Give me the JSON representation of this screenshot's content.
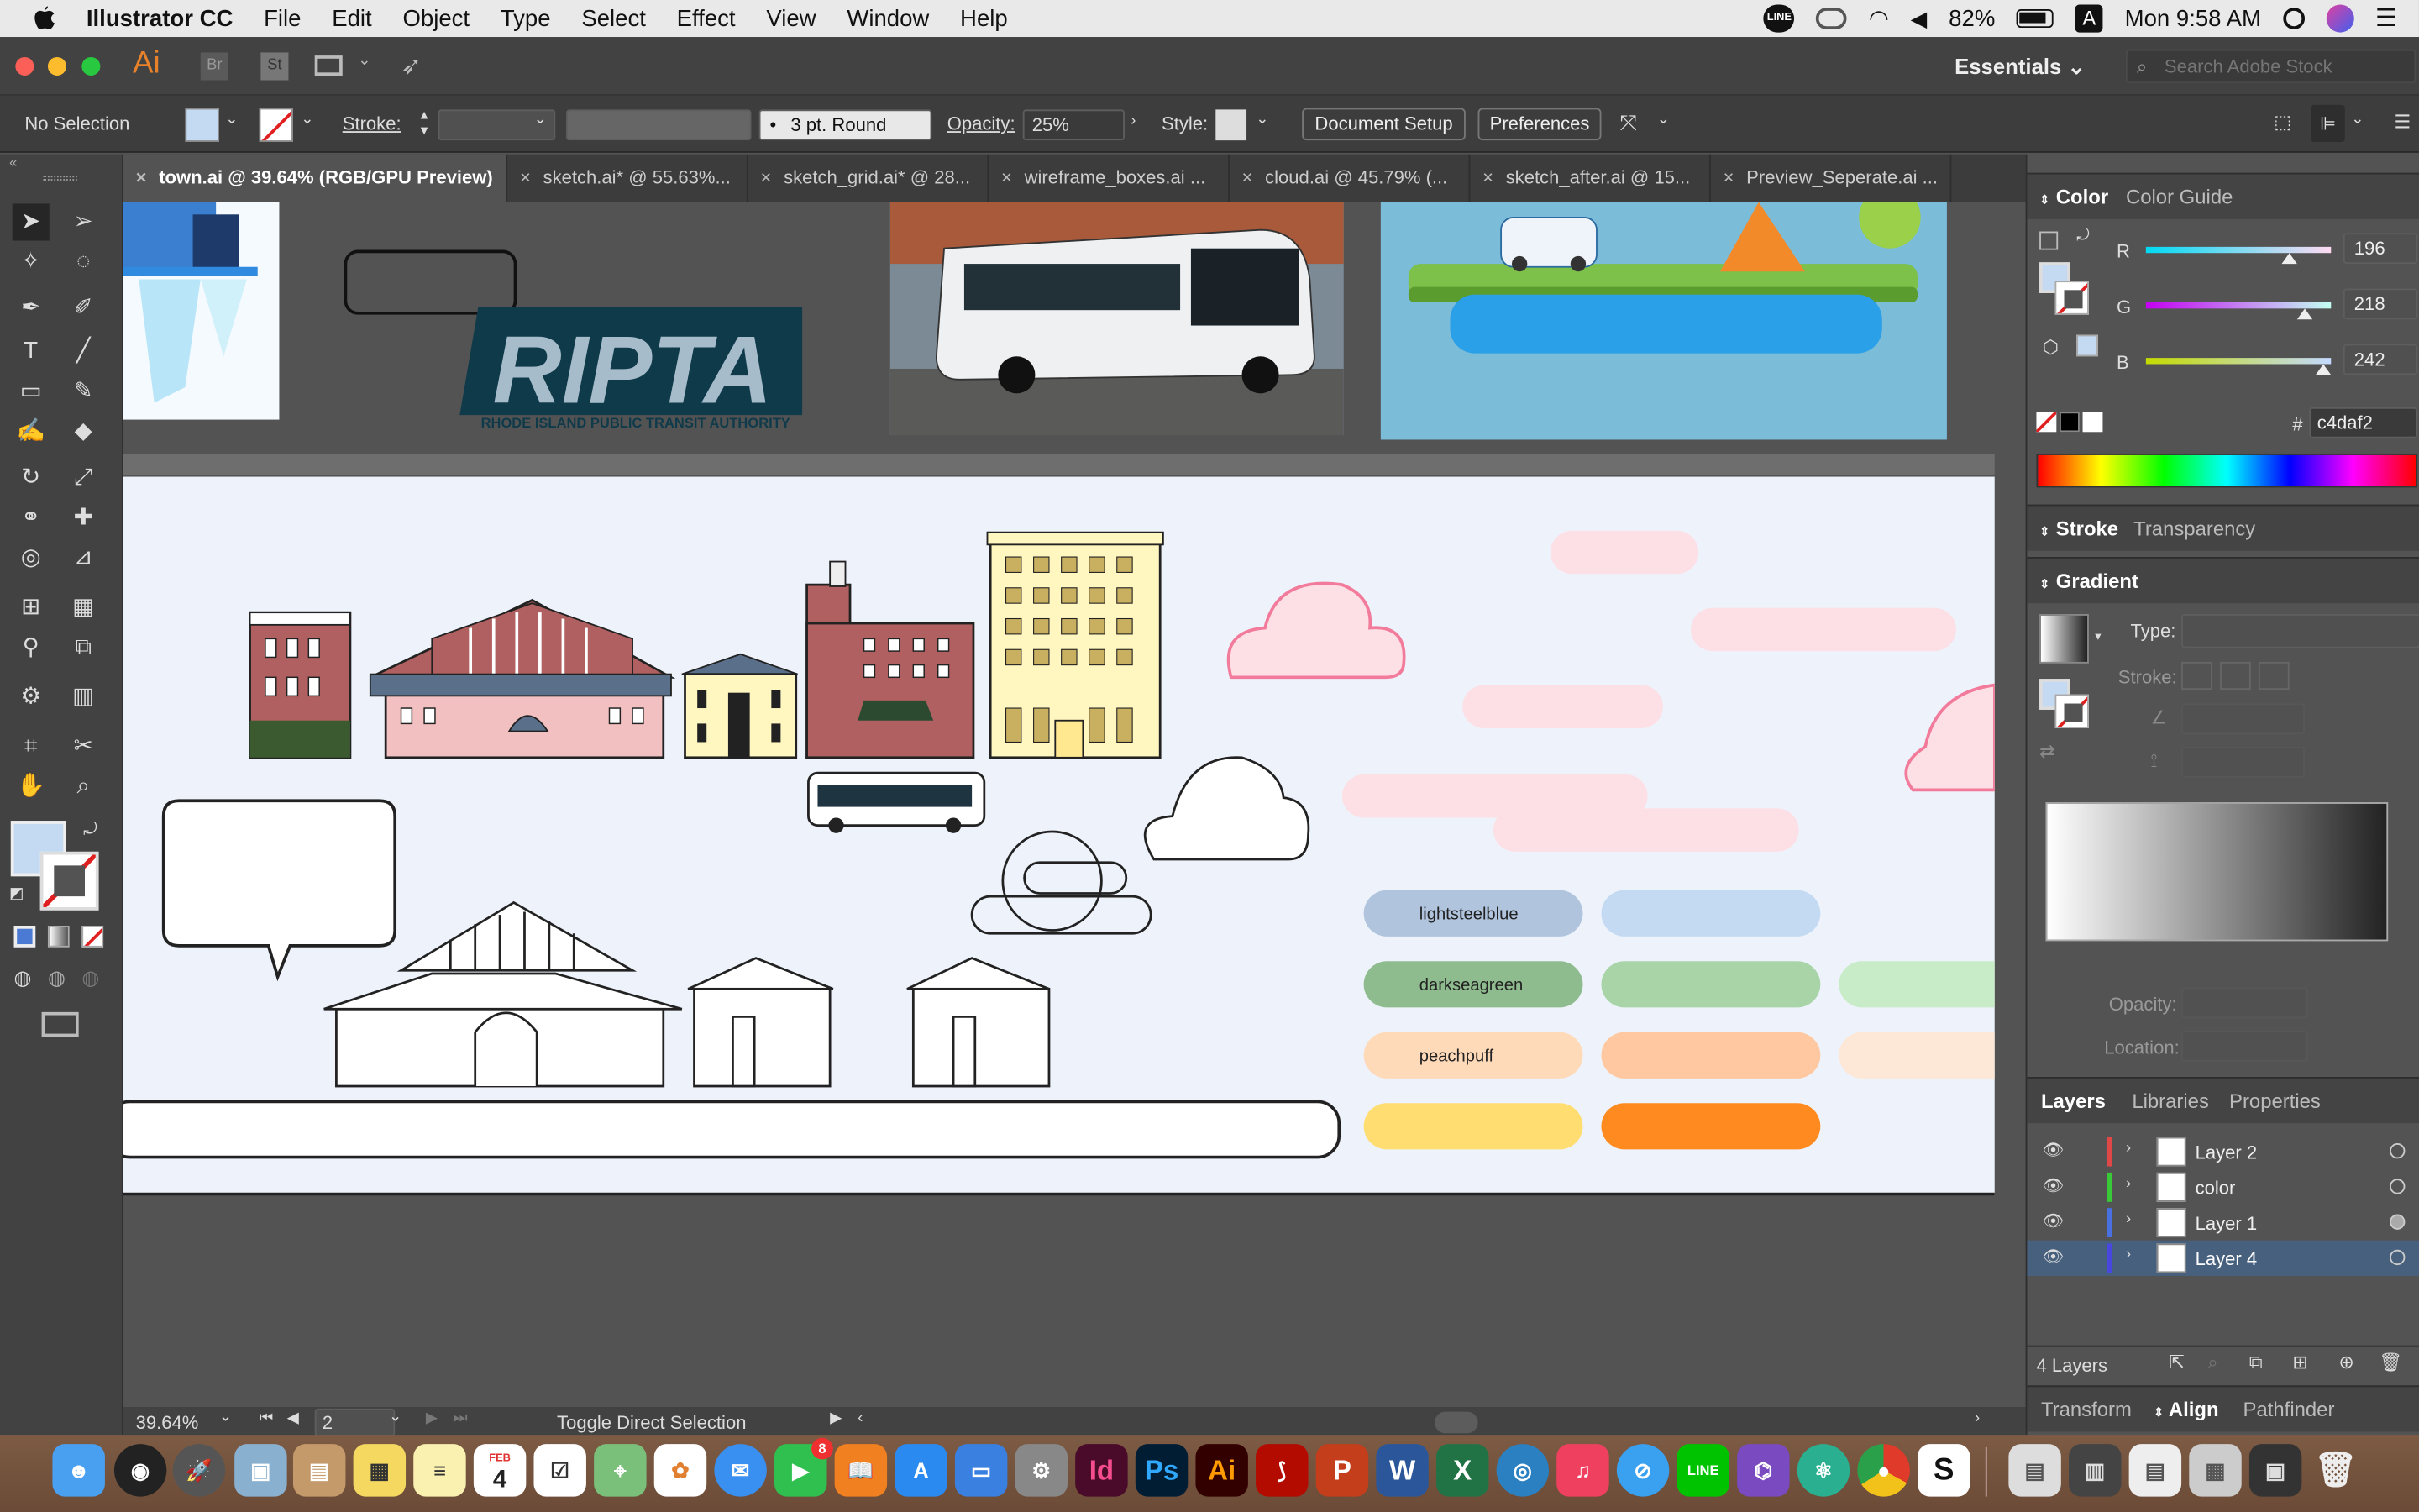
{
  "menubar": {
    "apple": "",
    "app_name": "Illustrator CC",
    "menus": [
      "File",
      "Edit",
      "Object",
      "Type",
      "Select",
      "Effect",
      "View",
      "Window",
      "Help"
    ],
    "battery": "82%",
    "input_indicator": "A",
    "clock": "Mon 9:58 AM"
  },
  "appbar": {
    "logo": "Ai",
    "bridge": "Br",
    "stock": "St",
    "workspace": "Essentials",
    "search_placeholder": "Search Adobe Stock"
  },
  "control_bar": {
    "selection": "No Selection",
    "stroke_label": "Stroke:",
    "brush": "3 pt. Round",
    "opacity_label": "Opacity:",
    "opacity_value": "25%",
    "style_label": "Style:",
    "document_setup": "Document Setup",
    "preferences": "Preferences"
  },
  "tabs": [
    {
      "label": "town.ai @ 39.64% (RGB/GPU Preview)"
    },
    {
      "label": "sketch.ai* @ 55.63%..."
    },
    {
      "label": "sketch_grid.ai* @ 28..."
    },
    {
      "label": "wireframe_boxes.ai ..."
    },
    {
      "label": "cloud.ai @ 45.79% (..."
    },
    {
      "label": "sketch_after.ai @ 15..."
    },
    {
      "label": "Preview_Seperate.ai ..."
    }
  ],
  "tab_close": "×",
  "artwork": {
    "logo_text": "RIPTA",
    "logo_subtitle": "RHODE ISLAND PUBLIC TRANSIT AUTHORITY",
    "swatch_labels": [
      "lightsteelblue",
      "darkseagreen",
      "peachpuff"
    ],
    "colors": {
      "pink_fill": "#fde0e6",
      "pink_stroke": "#f27a9a",
      "lightsteelblue": "#b0c4de",
      "lightsteelblue_light": "#c4daf2",
      "darkseagreen": "#8fbc8f",
      "darkseagreen_light": "#a8d4a8",
      "darkseagreen_lighter": "#c8ecc8",
      "peachpuff": "#ffdab9",
      "peachpuff_mid": "#ffc8a0",
      "peachpuff_light": "#fde8d8",
      "yellow": "#ffdd70",
      "orange": "#ff8a20",
      "brick": "#b06060",
      "cream": "#fff6c0",
      "slate": "#5a6f8a"
    }
  },
  "color_panel": {
    "tabs": [
      "Color",
      "Color Guide"
    ],
    "r_label": "R",
    "r_value": "196",
    "g_label": "G",
    "g_value": "218",
    "b_label": "B",
    "b_value": "242",
    "r_fraction": 0.77,
    "g_fraction": 0.85,
    "b_fraction": 0.95,
    "hex_label": "#",
    "hex": "c4daf2",
    "fill_color": "#c4daf2"
  },
  "stroke_panel": {
    "tabs": [
      "Stroke",
      "Transparency"
    ]
  },
  "gradient_panel": {
    "title": "Gradient",
    "type_label": "Type:",
    "stroke_label": "Stroke:",
    "opacity_label": "Opacity:",
    "location_label": "Location:"
  },
  "layers_panel": {
    "tabs": [
      "Layers",
      "Libraries",
      "Properties"
    ],
    "layers": [
      {
        "name": "Layer 2",
        "color": "#e04848"
      },
      {
        "name": "color",
        "color": "#38c838"
      },
      {
        "name": "Layer 1",
        "color": "#4870e0"
      },
      {
        "name": "Layer 4",
        "color": "#4848e0"
      }
    ],
    "count": "4 Layers"
  },
  "bottom_tabs": [
    "Transform",
    "Align",
    "Pathfinder"
  ],
  "status": {
    "zoom": "39.64%",
    "page": "2",
    "hint": "Toggle Direct Selection"
  },
  "dock": {
    "apps": [
      "Id",
      "Ps",
      "Ai",
      "P",
      "W",
      "X",
      "S"
    ],
    "calendar_month": "FEB",
    "calendar_day": "4",
    "facetime_badge": "8"
  }
}
